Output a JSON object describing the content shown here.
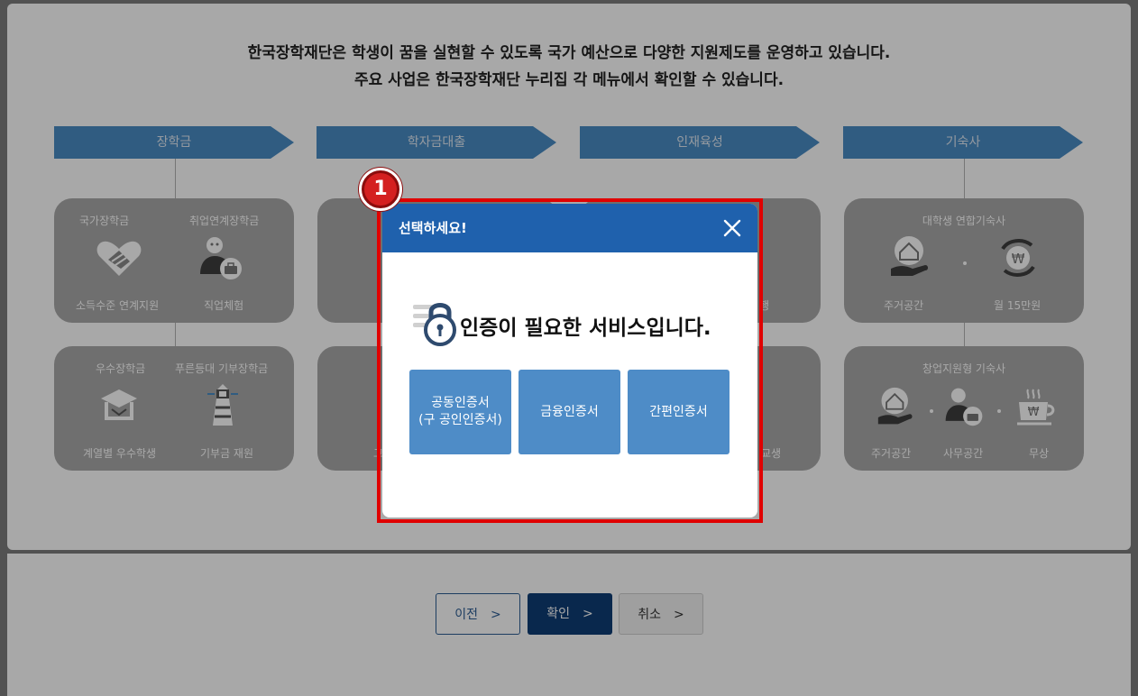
{
  "intro": {
    "line1": "한국장학재단은 학생이 꿈을 실현할 수 있도록 국가 예산으로 다양한 지원제도를 운영하고 있습니다.",
    "line2": "주요 사업은 한국장학재단 누리집 각 메뉴에서 확인할 수 있습니다."
  },
  "categories": [
    {
      "label": "장학금"
    },
    {
      "label": "학자금대출"
    },
    {
      "label": "인재육성"
    },
    {
      "label": "기숙사"
    }
  ],
  "scholarship": {
    "box1": {
      "title1": "국가장학금",
      "title2": "취업연계장학금",
      "caption1": "소득수준 연계지원",
      "caption2": "직업체험",
      "icon1": "handshake-heart-icon",
      "icon2": "person-briefcase-icon"
    },
    "box2": {
      "title1": "우수장학금",
      "title2": "푸른등대 기부장학금",
      "caption1": "계열별 우수학생",
      "caption2": "기부금 재원",
      "icon1": "graduation-cap-icon",
      "icon2": "lighthouse-icon"
    }
  },
  "loan_partial": {
    "caption_bottom": "고"
  },
  "talent_partial": {
    "caption_top": "행",
    "caption_bottom": "교생"
  },
  "dormitory": {
    "box1": {
      "title": "대학생 연합기숙사",
      "caption1": "주거공간",
      "caption2": "월 15만원",
      "icon1": "house-hand-icon",
      "icon2": "won-coin-icon"
    },
    "box2": {
      "title": "창업지원형 기숙사",
      "caption1": "주거공간",
      "caption2": "사무공간",
      "caption3": "무상",
      "icon1": "house-hand-icon",
      "icon2": "person-briefcase-icon",
      "icon3": "won-cup-icon"
    }
  },
  "nav": {
    "prev": "이전",
    "confirm": "확인",
    "cancel": "취소",
    "chevron": ">"
  },
  "modal": {
    "title": "선택하세요!",
    "message": "인증이 필요한 서비스입니다.",
    "buttons": [
      {
        "line1": "공동인증서",
        "line2": "(구 공인인증서)"
      },
      {
        "line1": "금융인증서",
        "line2": ""
      },
      {
        "line1": "간편인증서",
        "line2": ""
      }
    ]
  },
  "badge": {
    "number": "1"
  },
  "colors": {
    "header_blue": "#1f61ad",
    "button_blue": "#4e8cc7",
    "confirm_navy": "#0e3d75",
    "highlight_red": "#e00000"
  }
}
